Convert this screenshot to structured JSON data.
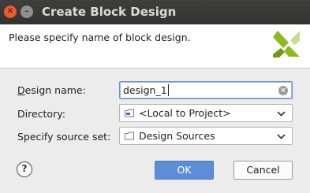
{
  "window": {
    "title": "Create Block Design",
    "close_glyph": "✕",
    "minimize_glyph": "–"
  },
  "header": {
    "description": "Please specify name of block design.",
    "logo_icon": "xilinx-logo"
  },
  "form": {
    "design_name": {
      "label_mnemonic": "D",
      "label_rest": "esign name:",
      "value": "design_1"
    },
    "directory": {
      "label": "Directory:",
      "value": "<Local to Project>"
    },
    "source_set": {
      "label": "Specify source set:",
      "value": "Design Sources"
    }
  },
  "buttons": {
    "help": "?",
    "ok": "OK",
    "cancel": "Cancel"
  },
  "colors": {
    "titlebar": "#363634",
    "ok_button": "#5b8ed6",
    "logo_green": "#8cba1f"
  }
}
